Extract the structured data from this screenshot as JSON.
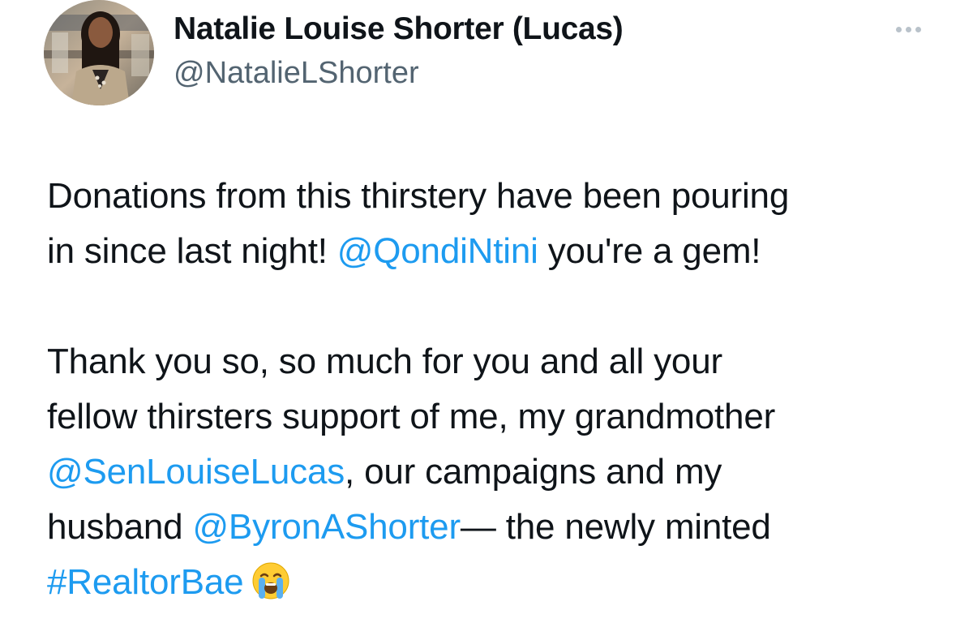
{
  "author": {
    "display_name": "Natalie Louise Shorter (Lucas)",
    "handle": "@NatalieLShorter"
  },
  "more_icon": "more-horizontal-icon",
  "tweet": {
    "line1": "Donations from this thirstery have been pouring",
    "line2_prefix": "in since last night! ",
    "mention_qondi": "@QondiNtini",
    "line2_suffix": " you're a gem!",
    "line3": "Thank you so, so much for you and all your",
    "line4": "fellow thirsters support of me, my grandmother",
    "mention_senator": "@SenLouiseLucas",
    "line5_suffix": ", our campaigns and my",
    "line6_prefix": "husband ",
    "mention_byron": "@ByronAShorter",
    "line6_suffix": "— the newly minted",
    "hashtag": "#RealtorBae",
    "emoji": "loudly-crying-face-emoji"
  },
  "colors": {
    "link": "#1d9bf0",
    "text": "#0f1419",
    "secondary": "#536471"
  }
}
